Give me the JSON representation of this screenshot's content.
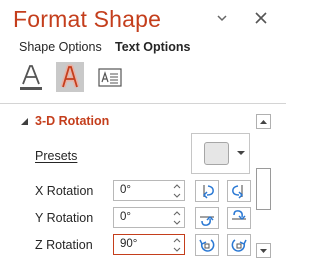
{
  "pane": {
    "title": "Format Shape",
    "header_icons": [
      "chevron-down-icon",
      "close-icon"
    ]
  },
  "tabs": {
    "shape_options": "Shape Options",
    "text_options": "Text Options",
    "selected": "text_options"
  },
  "category_icons": [
    "text-fill-outline-icon",
    "text-effects-icon",
    "textbox-icon"
  ],
  "section": {
    "title": "3-D Rotation",
    "expanded": true
  },
  "presets": {
    "label": "Presets"
  },
  "rotations": {
    "x": {
      "label": "X Rotation",
      "value": "0°"
    },
    "y": {
      "label": "Y Rotation",
      "value": "0°"
    },
    "z": {
      "label": "Z Rotation",
      "value": "90°"
    }
  },
  "colors": {
    "accent": "#c43e1c",
    "rotate_icon": "#2b79d4",
    "selected_category_bg": "#c9c9c9"
  }
}
